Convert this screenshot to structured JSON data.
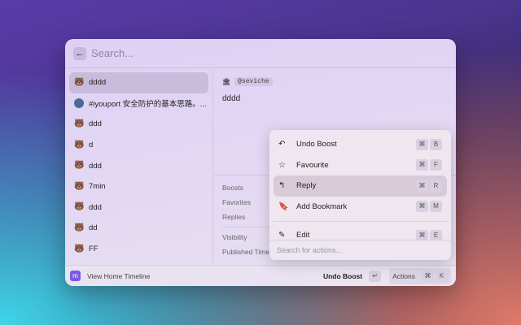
{
  "search": {
    "placeholder": "Search..."
  },
  "timeline": [
    {
      "text": "dddd",
      "avatar": "cartoon-avatar",
      "selected": true
    },
    {
      "text": "#iyouport 安全防护的基本思路。...",
      "avatar": "round-avatar"
    },
    {
      "text": "ddd",
      "avatar": "cartoon-avatar"
    },
    {
      "text": "d",
      "avatar": "cartoon-avatar"
    },
    {
      "text": "ddd",
      "avatar": "cartoon-avatar"
    },
    {
      "text": "7min",
      "avatar": "cartoon-avatar"
    },
    {
      "text": "ddd",
      "avatar": "cartoon-avatar"
    },
    {
      "text": "dd",
      "avatar": "cartoon-avatar"
    },
    {
      "text": "FF",
      "avatar": "cartoon-avatar"
    }
  ],
  "detail": {
    "handle": "@seviche",
    "content": "dddd",
    "meta": [
      "Boosts",
      "Favorites",
      "Replies"
    ],
    "meta2": [
      "Visibility",
      "Published Time"
    ]
  },
  "menu": {
    "items": [
      {
        "label": "Undo Boost",
        "icon": "undo-icon",
        "glyph": "↶",
        "key": "B"
      },
      {
        "label": "Favourite",
        "icon": "star-icon",
        "glyph": "☆",
        "key": "F"
      },
      {
        "label": "Reply",
        "icon": "reply-icon",
        "glyph": "↰",
        "key": "R",
        "selected": true
      },
      {
        "label": "Add Bookmark",
        "icon": "bookmark-icon",
        "glyph": "🔖",
        "key": "M"
      }
    ],
    "item2": {
      "label": "Edit",
      "icon": "pencil-icon",
      "glyph": "✎",
      "key": "E"
    },
    "cmd": "⌘",
    "search_placeholder": "Search for actions..."
  },
  "footer": {
    "title": "View Home Timeline",
    "primary": "Undo Boost",
    "enter": "↵",
    "actions": "Actions",
    "cmd": "⌘",
    "k": "K"
  },
  "colors": {
    "accent": "#7a5ae0"
  }
}
